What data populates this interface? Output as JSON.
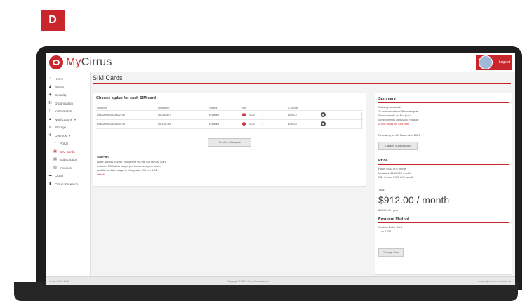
{
  "figure_label": "D",
  "app": {
    "logo_my": "My",
    "logo_cirrus": "Cirrus",
    "user_label": "Logout"
  },
  "page_title": "SIM Cards",
  "sidebar": {
    "items": [
      {
        "label": "Home",
        "icon": "home-icon",
        "glyph": "⌂"
      },
      {
        "label": "Profile",
        "icon": "person-icon",
        "glyph": "♟"
      },
      {
        "label": "Security",
        "icon": "shield-icon",
        "glyph": "◈"
      },
      {
        "label": "Organisation",
        "icon": "people-icon",
        "glyph": "☷"
      },
      {
        "label": "Instruments",
        "icon": "instrument-icon",
        "glyph": "▯"
      },
      {
        "label": "Notifications",
        "icon": "bell-icon",
        "glyph": "▲"
      },
      {
        "label": "Storage",
        "icon": "storage-icon",
        "glyph": "≡"
      },
      {
        "label": "Optimus",
        "icon": "gear-icon",
        "glyph": "✲"
      },
      {
        "label": "Portal",
        "icon": "portal-icon",
        "glyph": "▪"
      },
      {
        "label": "SIM Cards",
        "icon": "sim-card-icon",
        "glyph": "▣"
      },
      {
        "label": "Subscription",
        "icon": "subscription-icon",
        "glyph": "▤"
      },
      {
        "label": "Invoices",
        "icon": "invoice-icon",
        "glyph": "▥"
      },
      {
        "label": "Cloud",
        "icon": "cloud-icon",
        "glyph": "☁"
      },
      {
        "label": "Cirrus Research",
        "icon": "chart-icon",
        "glyph": "▮"
      }
    ]
  },
  "sim_panel": {
    "title": "Choose a plan for each SIM card",
    "headers": {
      "number": "Number",
      "quantum": "Quantum",
      "status": "Status",
      "plan": "Plan",
      "charge": "Charge"
    },
    "rows": [
      {
        "number": "8935205941435022190",
        "quantum": "QC434427",
        "status": "Enabled",
        "plan": "SO3",
        "charge": "£69.00"
      },
      {
        "number": "8935205941435024741",
        "quantum": "QC134715",
        "status": "Enabled",
        "plan": "SO3",
        "charge": "£96.50"
      }
    ],
    "confirm_button": "Confirm Changes",
    "sim_plan_title": "SIM Plan",
    "sim_plan_line1": "Allow access to your instrument via the Cirrus SIM Card,",
    "sim_plan_line2": "includes 5GB data usage per instrument per month.",
    "sim_plan_line3": "Additional data usage is charged at £10 per 1GB.",
    "details_link": "Details"
  },
  "summary": {
    "title": "Summary",
    "line1": "Subscription active",
    "line2": "11 instruments on Standard plan",
    "line3": "0 instruments on Pro plan",
    "line4": "0 instruments with Audio module",
    "line5": "2 SIM cards on SIM plan",
    "renewing": "Renewing on 8th November 2021",
    "cancel_button": "Cancel Subscription",
    "price_title": "Price",
    "price1": "Plans $583.00 / month",
    "price2": "Modules: $130.00 / month",
    "price3": "SIM Cards: $200.00 / month",
    "total_label": "Total",
    "total_price": "$912.00 / month",
    "yearly": "$10,944.00 / year",
    "payment_title": "Payment Method",
    "card_label": "Ovation Debit Card",
    "card_number": "••• 1234",
    "change_card_button": "Change Card"
  },
  "footer": {
    "left": "Version 2.10.1963",
    "center": "Copyright © 2021 Cirrus Research plc",
    "right": "support@cirrusresearch.co.uk"
  }
}
